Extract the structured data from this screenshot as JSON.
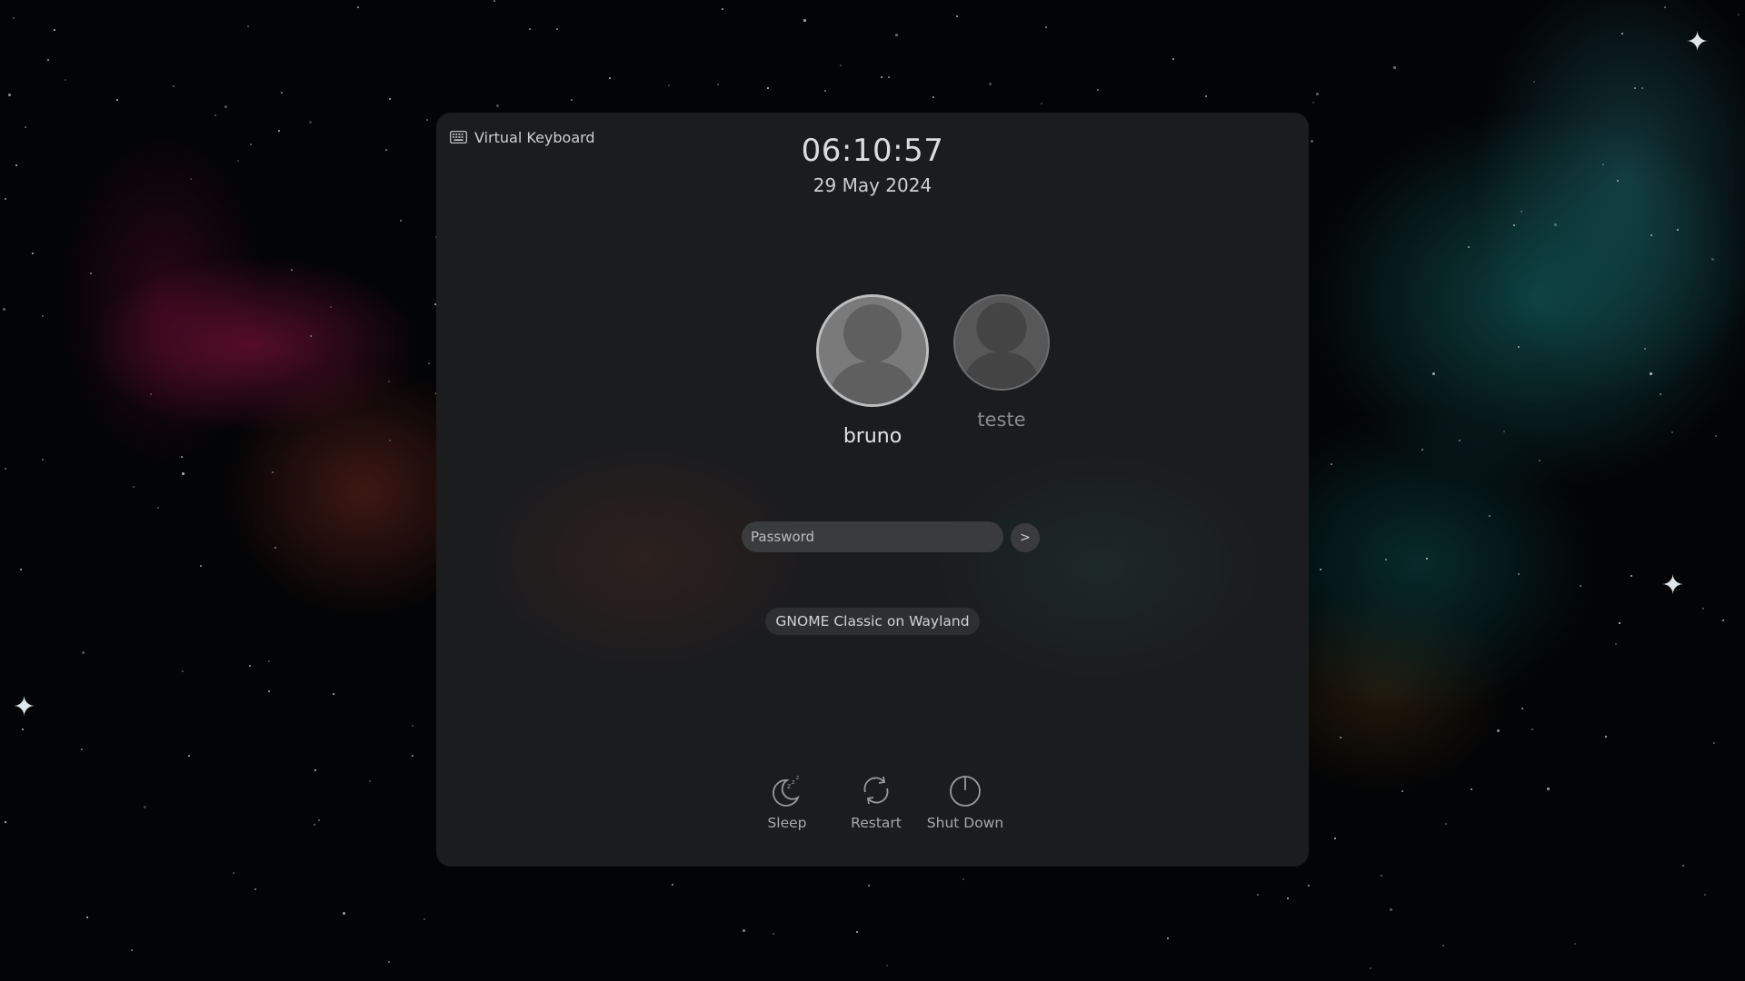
{
  "top_bar": {
    "virtual_keyboard_label": "Virtual Keyboard"
  },
  "clock": {
    "time": "06:10:57",
    "date": "29 May 2024"
  },
  "users": [
    {
      "name": "bruno",
      "selected": true
    },
    {
      "name": "teste",
      "selected": false
    }
  ],
  "login": {
    "password_placeholder": "Password",
    "password_value": "",
    "submit_label": ">"
  },
  "session": {
    "selected": "GNOME Classic on Wayland"
  },
  "power": {
    "sleep_label": "Sleep",
    "restart_label": "Restart",
    "shutdown_label": "Shut Down"
  },
  "icons": {
    "keyboard": "keyboard-icon",
    "avatar": "user-avatar-icon",
    "sleep": "moon-zzz-icon",
    "restart": "restart-arrows-icon",
    "shutdown": "power-icon"
  },
  "colors": {
    "panel_background": "#1b1c1e",
    "input_background": "#3a3b3d",
    "text_primary": "#e2e2e2",
    "text_muted": "#a8a8a8"
  }
}
